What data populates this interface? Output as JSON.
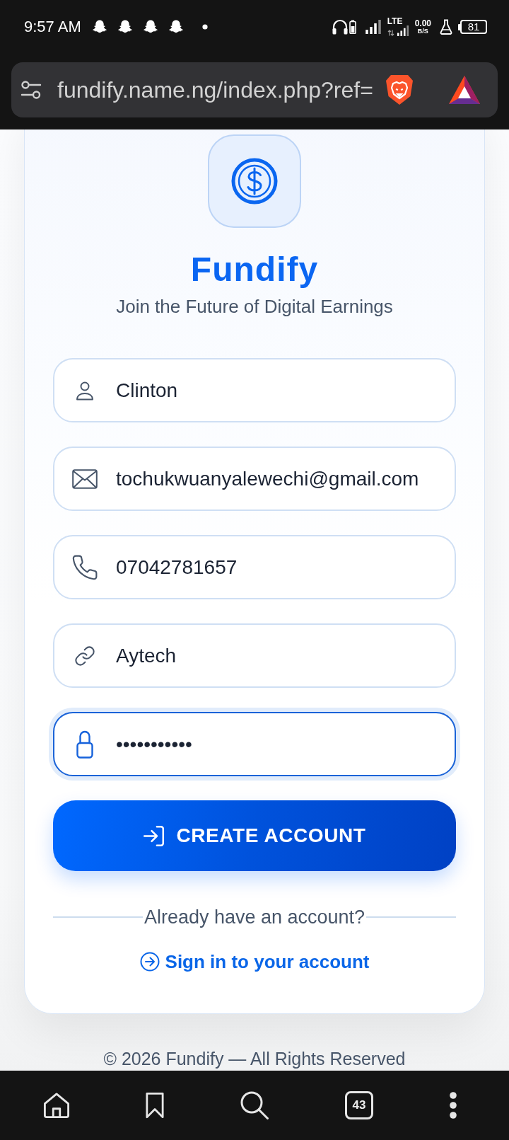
{
  "status_bar": {
    "time": "9:57 AM",
    "network_type": "LTE",
    "data_rate": "0.00",
    "data_rate_unit": "B/S",
    "battery": "81"
  },
  "browser_bar": {
    "url": "fundify.name.ng/index.php?ref="
  },
  "brand": {
    "name": "Fundify",
    "tagline": "Join the Future of Digital Earnings"
  },
  "fields": [
    {
      "kind": "name",
      "value": "Clinton",
      "focused": false
    },
    {
      "kind": "email",
      "value": "tochukwuanyalewechi@gmail.com",
      "focused": false
    },
    {
      "kind": "phone",
      "value": "07042781657",
      "focused": false
    },
    {
      "kind": "referral",
      "value": "Aytech",
      "focused": false
    },
    {
      "kind": "password",
      "value": "•••••••••••",
      "focused": true
    }
  ],
  "submit_button": {
    "label": "CREATE ACCOUNT"
  },
  "signin_prompt": {
    "text": "Already have an account?",
    "link": "Sign in to your account"
  },
  "footer": {
    "text": "© 2026 Fundify — All Rights Reserved"
  },
  "bottom_nav": {
    "tab_count": "43"
  }
}
